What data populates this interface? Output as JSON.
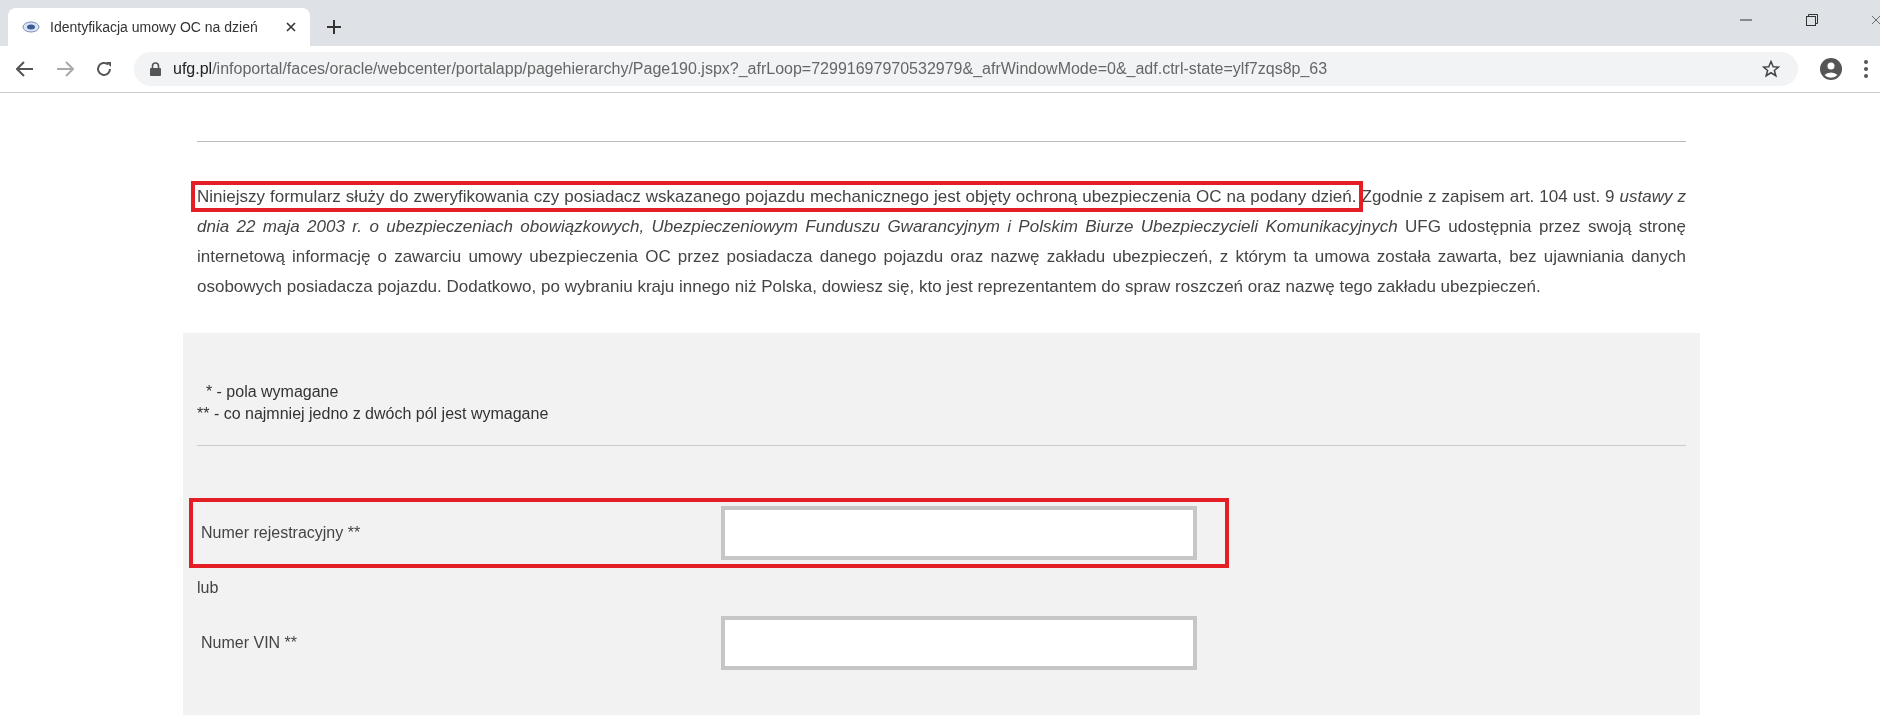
{
  "browser": {
    "tab": {
      "title": "Identyfikacja umowy OC na dzień",
      "selected": true
    },
    "url": {
      "host": "ufg.pl",
      "path": "/infoportal/faces/oracle/webcenter/portalapp/pagehierarchy/Page190.jspx?_afrLoop=72991697970532979&_afrWindowMode=0&_adf.ctrl-state=ylf7zqs8p_63"
    }
  },
  "intro": {
    "highlighted_part": "Niniejszy formularz służy do zweryfikowania czy posiadacz wskazanego pojazdu mechanicznego jest objęty ochroną ubezpieczenia OC na podany dzień.",
    "rest": "Zgodnie z zapisem art. 104 ust. 9 *ustawy z dnia 22 maja 2003 r. o ubezpieczeniach obowiązkowych, Ubezpieczeniowym Funduszu Gwarancyjnym i Polskim Biurze Ubezpieczycieli Komunikacyjnych* UFG udostępnia przez swoją stronę internetową informację o zawarciu umowy ubezpieczenia OC przez posiadacza danego pojazdu oraz nazwę zakładu ubezpieczeń, z którym ta umowa została zawarta, bez ujawniania danych osobowych posiadacza pojazdu. Dodatkowo, po wybraniu kraju innego niż Polska, dowiesz się, kto jest reprezentantem do spraw roszczeń oraz nazwę tego zakładu ubezpieczeń."
  },
  "form": {
    "legend": [
      "  * - pola wymagane",
      "** - co najmniej jedno z dwóch pól jest wymagane"
    ],
    "rows": [
      {
        "kind": "field",
        "label": "Numer rejestracyjny **",
        "highlighted": true
      },
      {
        "kind": "text",
        "label": "lub"
      },
      {
        "kind": "field",
        "label": "Numer VIN **",
        "highlighted": false
      }
    ]
  }
}
